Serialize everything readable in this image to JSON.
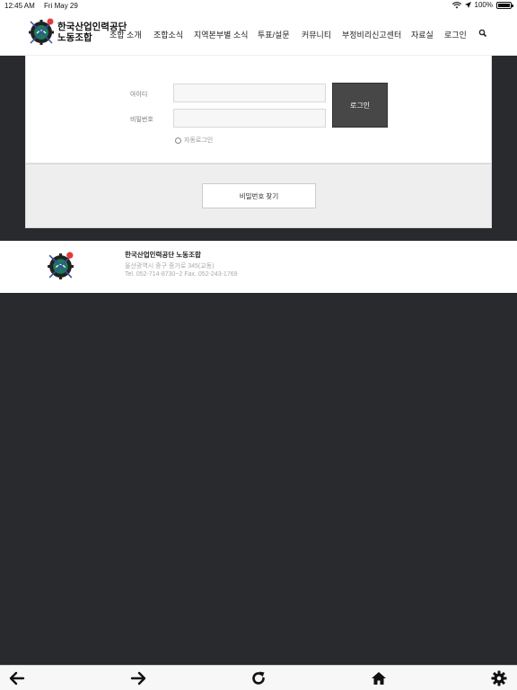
{
  "status_bar": {
    "time": "12:45 AM",
    "date": "Fri May 29",
    "battery": "100%"
  },
  "header": {
    "logo_line1": "한국산업인력공단",
    "logo_line2": "노동조합",
    "nav": [
      "조합 소개",
      "조합소식",
      "지역본부별 소식",
      "투표/설문",
      "커뮤니티",
      "부정비리신고센터",
      "자료실",
      "로그인"
    ],
    "search_icon": "search-icon"
  },
  "login": {
    "id_label": "아이디",
    "pw_label": "비밀번호",
    "id_value": "",
    "pw_value": "",
    "button": "로그인",
    "auto_login": "자동로그인",
    "find_password": "비밀번호 찾기"
  },
  "footer": {
    "title": "한국산업인력공단 노동조합",
    "address": "울산광역시 중구 종가로 345(교동)",
    "contact": "Tel. 052-714-8730~2 Fax. 052-243-1769"
  },
  "toolbar": {
    "icons": [
      "arrow-left-icon",
      "arrow-right-icon",
      "refresh-icon",
      "home-icon",
      "gear-icon"
    ]
  },
  "colors": {
    "page_background": "#282a2d",
    "login_button": "#474747",
    "panel_gray": "#eeeeee",
    "logo_green": "#1a7a5c",
    "logo_red": "#e23a3a"
  }
}
